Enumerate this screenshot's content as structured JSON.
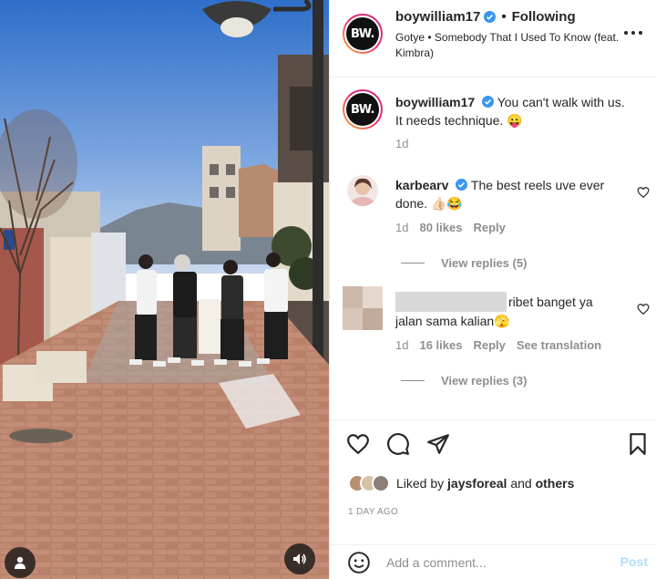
{
  "header": {
    "username": "boywilliam17",
    "avatar_text": "BW.",
    "separator": "•",
    "follow_status": "Following",
    "audio": "Gotye • Somebody That I Used To Know (feat. Kimbra)",
    "more_icon": "more-horizontal-icon"
  },
  "caption": {
    "username": "boywilliam17",
    "text": "You can't walk with us. It needs technique. 😛",
    "time": "1d"
  },
  "comments": [
    {
      "username": "karbearv",
      "verified": true,
      "text": "The best reels uve ever done. 👍🏻😂",
      "time": "1d",
      "likes": "80 likes",
      "reply": "Reply",
      "view_replies": "View replies (5)"
    },
    {
      "username": "",
      "text_a": "ribet banget ya",
      "text_b": "jalan sama kalian🫣",
      "time": "1d",
      "likes": "16 likes",
      "reply": "Reply",
      "see_translation": "See translation",
      "view_replies": "View replies (3)"
    }
  ],
  "actions": {
    "like_icon": "heart-icon",
    "comment_icon": "comment-icon",
    "share_icon": "send-icon",
    "save_icon": "bookmark-icon"
  },
  "likes": {
    "prefix": "Liked by",
    "user": "jaysforeal",
    "conjunction": "and",
    "others": "others"
  },
  "date": "1 DAY AGO",
  "add_comment": {
    "placeholder": "Add a comment...",
    "post_label": "Post"
  },
  "colors": {
    "verified": "#3897f0",
    "post_disabled": "#b2dffc",
    "muted_text": "#8e8e8e"
  }
}
